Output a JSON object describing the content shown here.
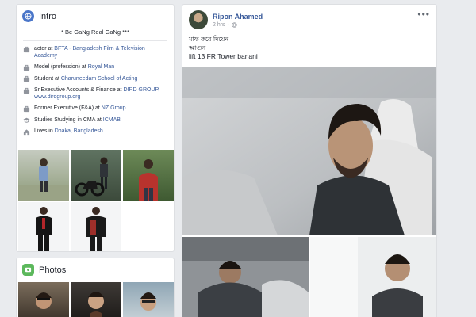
{
  "intro": {
    "title": "Intro",
    "tagline": "* Be GaNg Real GaNg ***",
    "items": [
      {
        "icon": "briefcase-icon",
        "prefix": "actor at ",
        "link": "BFTA - Bangladesh Film & Television Academy",
        "suffix": ""
      },
      {
        "icon": "briefcase-icon",
        "prefix": "Model (profession) at ",
        "link": "Royal Man",
        "suffix": ""
      },
      {
        "icon": "briefcase-icon",
        "prefix": "Student at ",
        "link": "Charuneedam School of Acting",
        "suffix": ""
      },
      {
        "icon": "briefcase-icon",
        "prefix": "Sr.Executive Accounts & Finance at ",
        "link": "DIRD GROUP",
        "suffix": ", www.dirdgroup.org"
      },
      {
        "icon": "briefcase-icon",
        "prefix": "Former Executive (F&A) at ",
        "link": "NZ Group",
        "suffix": ""
      },
      {
        "icon": "graduation-cap-icon",
        "prefix": "Studies Studying in CMA at ",
        "link": "ICMAB",
        "suffix": ""
      },
      {
        "icon": "home-icon",
        "prefix": "Lives in ",
        "link": "Dhaka, Bangladesh",
        "suffix": ""
      }
    ]
  },
  "photos": {
    "title": "Photos"
  },
  "post": {
    "author": "Ripon Ahamed",
    "time": "2 hrs",
    "more": "•••",
    "lines": [
      "মাফ করে দিয়েন",
      "আগুন",
      "lift 13 FR Tower banani"
    ]
  },
  "colors": {
    "link": "#365899",
    "background": "#e9ebee",
    "card": "#ffffff"
  }
}
